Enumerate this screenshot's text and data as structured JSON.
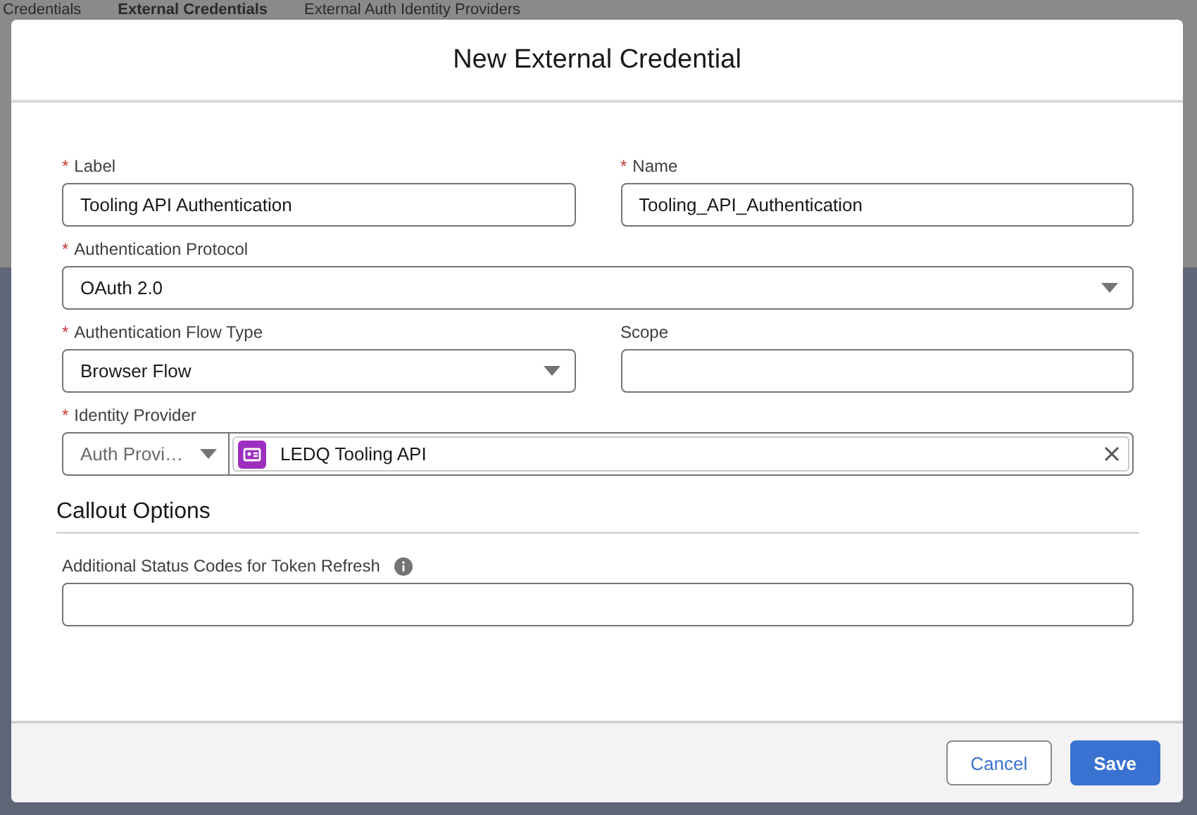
{
  "background_tabs": [
    {
      "label": "Credentials",
      "selected": false
    },
    {
      "label": "External Credentials",
      "selected": true
    },
    {
      "label": "External Auth Identity Providers",
      "selected": false
    }
  ],
  "modal": {
    "title": "New External Credential",
    "rows": [
      [
        {
          "kind": "text",
          "label": "Label",
          "required_mark": "*",
          "value": "Tooling API Authentication"
        },
        {
          "kind": "text",
          "label": "Name",
          "required_mark": "*",
          "value": "Tooling_API_Authentication"
        }
      ],
      [
        {
          "kind": "combobox",
          "label": "Authentication Protocol",
          "required_mark": "*",
          "value": "OAuth 2.0"
        }
      ],
      [
        {
          "kind": "combobox",
          "label": "Authentication Flow Type",
          "required_mark": "*",
          "value": "Browser Flow"
        },
        {
          "kind": "text",
          "label": "Scope"
        }
      ],
      [
        {
          "kind": "lookup",
          "label": "Identity Provider",
          "required_mark": "*",
          "type_value": "Auth Provi…",
          "value": "LEDQ Tooling API"
        }
      ]
    ],
    "section": {
      "title": "Callout Options",
      "rows": [
        [
          {
            "kind": "text",
            "label": "Additional Status Codes for Token Refresh",
            "info": true
          }
        ]
      ]
    },
    "buttons": [
      {
        "label": "Cancel"
      },
      {
        "label": "Save"
      }
    ]
  }
}
